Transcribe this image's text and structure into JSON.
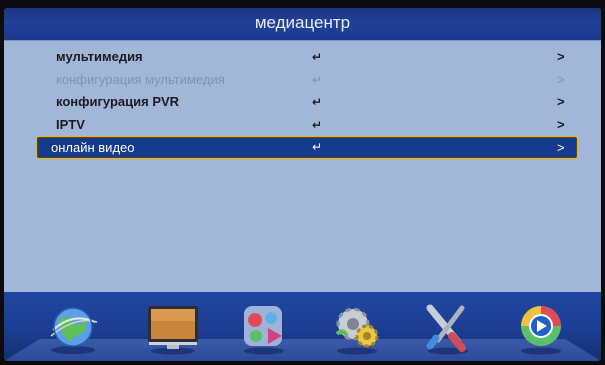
{
  "title": "медиацентр",
  "menu": {
    "items": [
      {
        "label": "мультимедия",
        "enter": "↵",
        "arrow": ">"
      },
      {
        "label": "конфигурация мультимедия",
        "enter": "↵",
        "arrow": ">"
      },
      {
        "label": "конфигурация PVR",
        "enter": "↵",
        "arrow": ">"
      },
      {
        "label": "IPTV",
        "enter": "↵",
        "arrow": ">"
      },
      {
        "label": "онлайн видео",
        "enter": "↵",
        "arrow": ">"
      }
    ],
    "selected_index": 4,
    "disabled_index": 1
  },
  "dock": {
    "icons": [
      "globe-network-icon",
      "tv-monitor-icon",
      "media-apps-icon",
      "gear-settings-icon",
      "tools-icon",
      "play-button-icon"
    ]
  },
  "colors": {
    "title_bar": "#1f3f96",
    "background": "#a2b6d8",
    "selected_bg": "#153a8e",
    "selected_border": "#f0b400"
  }
}
